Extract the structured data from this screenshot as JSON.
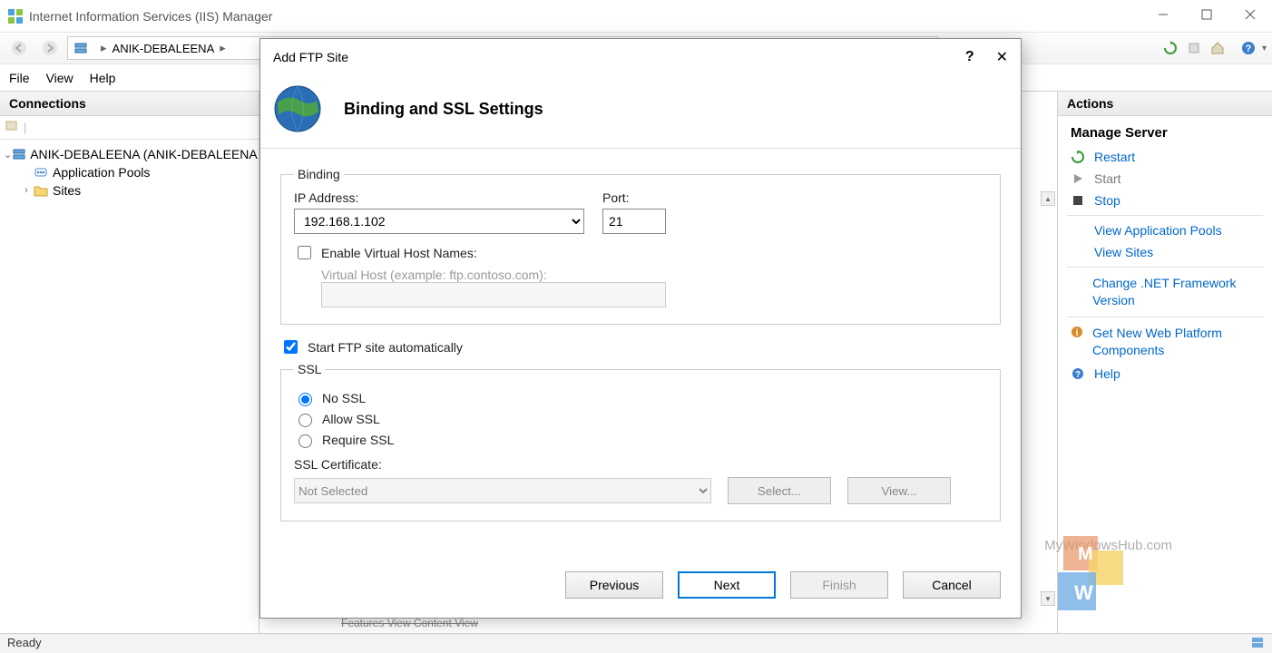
{
  "window": {
    "title": "Internet Information Services (IIS) Manager"
  },
  "breadcrumb": {
    "root_arrow": "▸",
    "node": "ANIK-DEBALEENA",
    "node_arrow": "▸"
  },
  "menu": {
    "file": "File",
    "view": "View",
    "help": "Help"
  },
  "panes": {
    "connections": "Connections",
    "actions": "Actions"
  },
  "tree": {
    "root": "ANIK-DEBALEENA (ANIK-DEBALEENA",
    "app_pools": "Application Pools",
    "sites": "Sites"
  },
  "actions": {
    "heading": "Manage Server",
    "restart": "Restart",
    "start": "Start",
    "stop": "Stop",
    "view_app_pools": "View Application Pools",
    "view_sites": "View Sites",
    "change_net": "Change .NET Framework Version",
    "get_webpi": "Get New Web Platform Components",
    "help": "Help"
  },
  "status": "Ready",
  "dialog": {
    "title": "Add FTP Site",
    "banner": "Binding and SSL Settings",
    "binding_legend": "Binding",
    "ip_label": "IP Address:",
    "ip_value": "192.168.1.102",
    "port_label": "Port:",
    "port_value": "21",
    "enable_vhost": "Enable Virtual Host Names:",
    "vhost_label": "Virtual Host (example: ftp.contoso.com):",
    "start_auto": "Start FTP site automatically",
    "ssl_legend": "SSL",
    "no_ssl": "No SSL",
    "allow_ssl": "Allow SSL",
    "require_ssl": "Require SSL",
    "ssl_cert_label": "SSL Certificate:",
    "ssl_cert_value": "Not Selected",
    "btn_select": "Select...",
    "btn_view": "View...",
    "btn_previous": "Previous",
    "btn_next": "Next",
    "btn_finish": "Finish",
    "btn_cancel": "Cancel"
  },
  "watermark": "MyWindowsHub.com",
  "mid_tabs": "Features View    Content View"
}
